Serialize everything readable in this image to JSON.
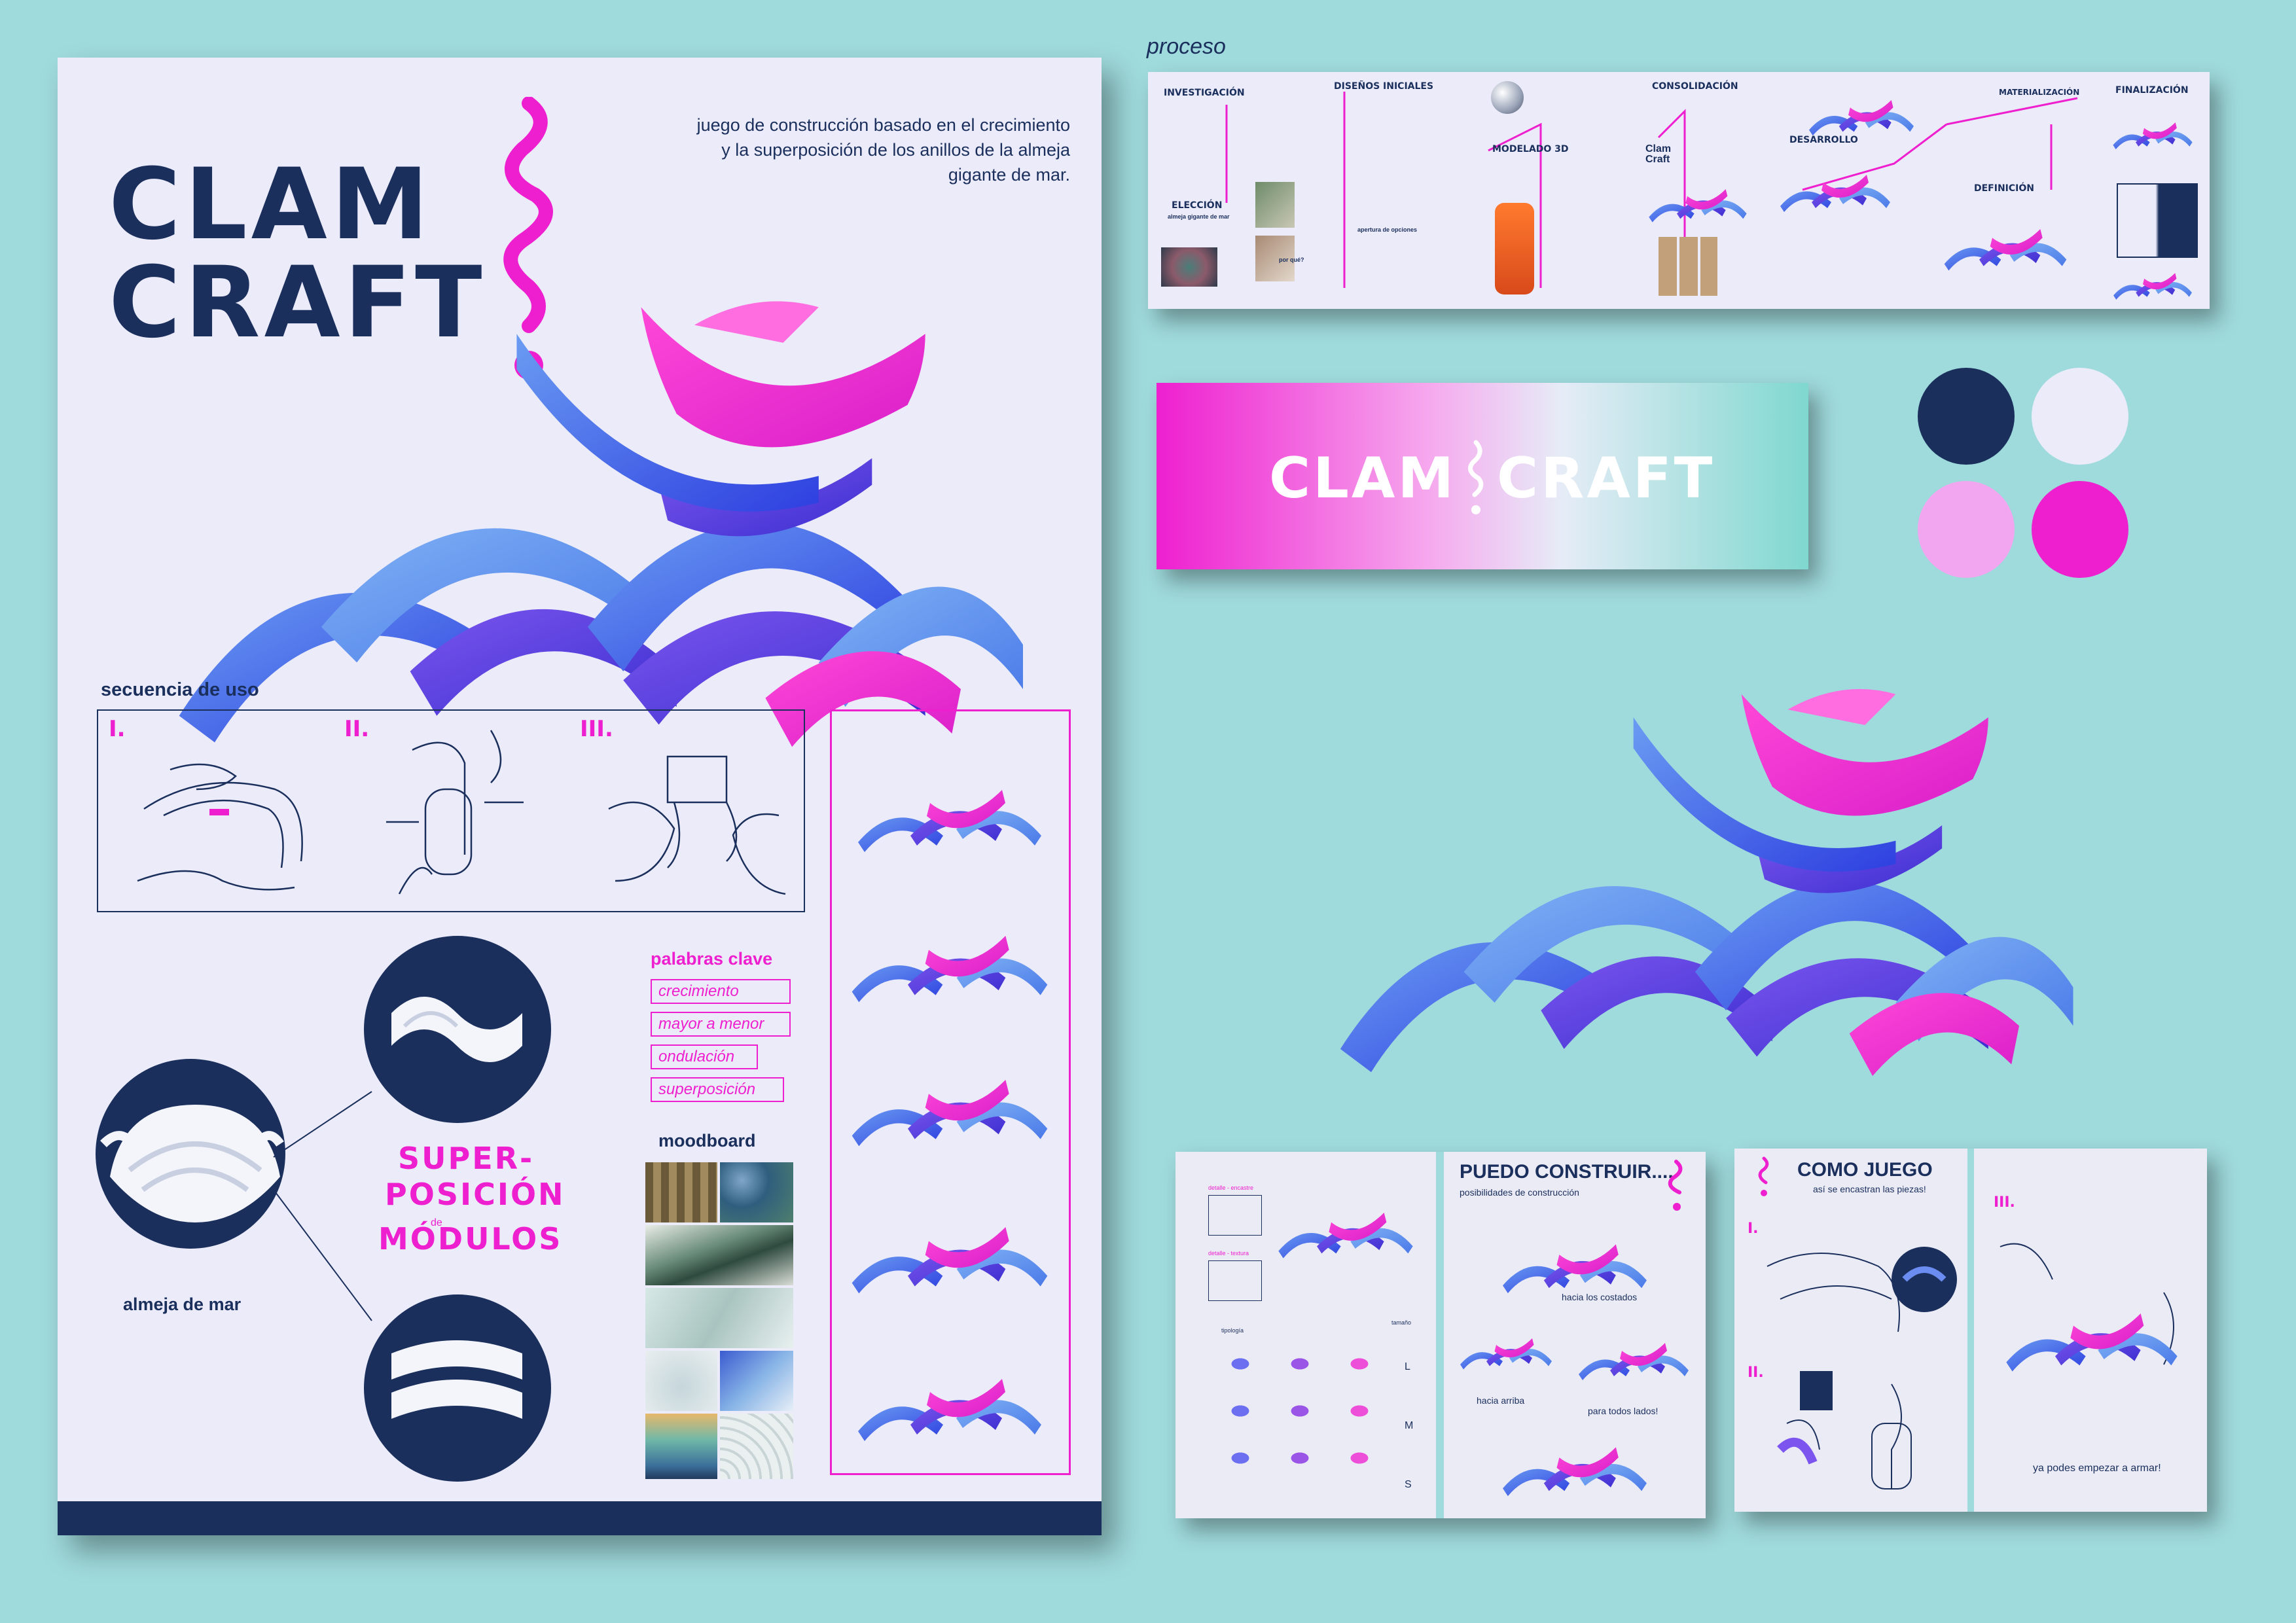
{
  "colors": {
    "background": "#9fdadc",
    "navy": "#1a2f5c",
    "pink": "#ee1fcf",
    "light_pink": "#f2a6f0",
    "lavender": "#ecebfa",
    "blue": "#3a4be8",
    "sky": "#5b8ef0"
  },
  "poster": {
    "title_line1": "CLAM",
    "title_line2": "CRAFT",
    "intro_line1": "juego de construcción basado en el crecimiento",
    "intro_line2": "y la superposición de los anillos de la almeja",
    "intro_line3": "gigante de mar.",
    "sequence_heading": "secuencia de uso",
    "steps": [
      "I.",
      "II.",
      "III."
    ],
    "keywords_heading": "palabras clave",
    "keywords": [
      "crecimiento",
      "mayor a menor",
      "ondulación",
      "superposición"
    ],
    "moodboard_heading": "moodboard",
    "super_line1": "SUPER-",
    "super_line2": "POSICIÓN",
    "super_de": "de",
    "super_line3": "MÓDULOS",
    "clam_label": "almeja de mar"
  },
  "process": {
    "label": "proceso",
    "headings": [
      "INVESTIGACIÓN",
      "DISEÑOS INICIALES",
      "ELECCIÓN",
      "MODELADO 3D",
      "CONSOLIDACIÓN",
      "DESARROLLO",
      "MATERIALIZACIÓN",
      "DEFINICIÓN",
      "FINALIZACIÓN"
    ],
    "clam_craft": "Clam Craft",
    "eleccion_text": "almeja gigante de mar",
    "apertura": "apertura de opciones",
    "porque": "por qué?"
  },
  "banner": {
    "left": "CLAM",
    "right": "CRAFT"
  },
  "palette": [
    "#1a2f5c",
    "#ecebfa",
    "#f2a6f0",
    "#ee1fcf"
  ],
  "book1": {
    "heading": "PUEDO CONSTRUIR....",
    "sub": "posibilidades de construcción",
    "caption1": "hacia los costados",
    "caption2": "hacia arriba",
    "caption3": "para todos lados!",
    "detail1": "detalle - encastre",
    "detail2": "detalle - textura",
    "tipologia": "tipología",
    "tamano": "tamaño",
    "sizes": [
      "L",
      "M",
      "S"
    ]
  },
  "book2": {
    "heading": "COMO JUEGO",
    "sub": "así se encastran las piezas!",
    "step1": "I.",
    "step2": "II.",
    "step3": "III.",
    "caption": "ya podes empezar a armar!"
  }
}
